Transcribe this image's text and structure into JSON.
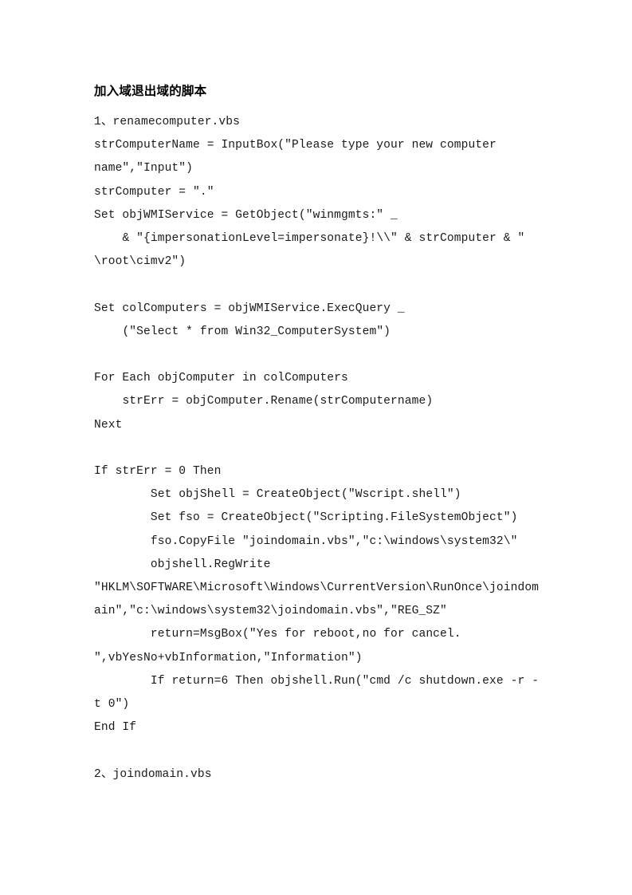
{
  "document": {
    "title": "加入域退出域的脚本",
    "page_background": "#ffffff",
    "text_color": "#1a1a1a",
    "lines": [
      "1、renamecomputer.vbs",
      "strComputerName = InputBox(″Please type your new computer name″,″Input″)",
      "strComputer = ″.″",
      "Set objWMIService = GetObject(″winmgmts:″ _",
      "    & ″{impersonationLevel=impersonate}!\\\\″ & strComputer & ″\\root\\cimv2″)",
      "",
      "Set colComputers = objWMIService.ExecQuery _",
      "    (″Select * from Win32_ComputerSystem″)",
      "",
      "For Each objComputer in colComputers",
      "    strErr = objComputer.Rename(strComputername)",
      "Next",
      "",
      "If strErr = 0 Then",
      "        Set objShell = CreateObject(″Wscript.shell″)",
      "        Set fso = CreateObject(″Scripting.FileSystemObject″)",
      "        fso.CopyFile ″joindomain.vbs″,″c:\\windows\\system32\\″",
      "        objshell.RegWrite ″HKLM\\SOFTWARE\\Microsoft\\Windows\\CurrentVersion\\RunOnce\\joindomain″,″c:\\windows\\system32\\joindomain.vbs″,″REG_SZ″",
      "        return=MsgBox(″Yes for reboot,no for cancel.″,vbYesNo+vbInformation,″Information″)",
      "        If return=6 Then objshell.Run(″cmd /c shutdown.exe -r -t 0″)",
      "End If",
      "",
      "2、joindomain.vbs"
    ]
  }
}
